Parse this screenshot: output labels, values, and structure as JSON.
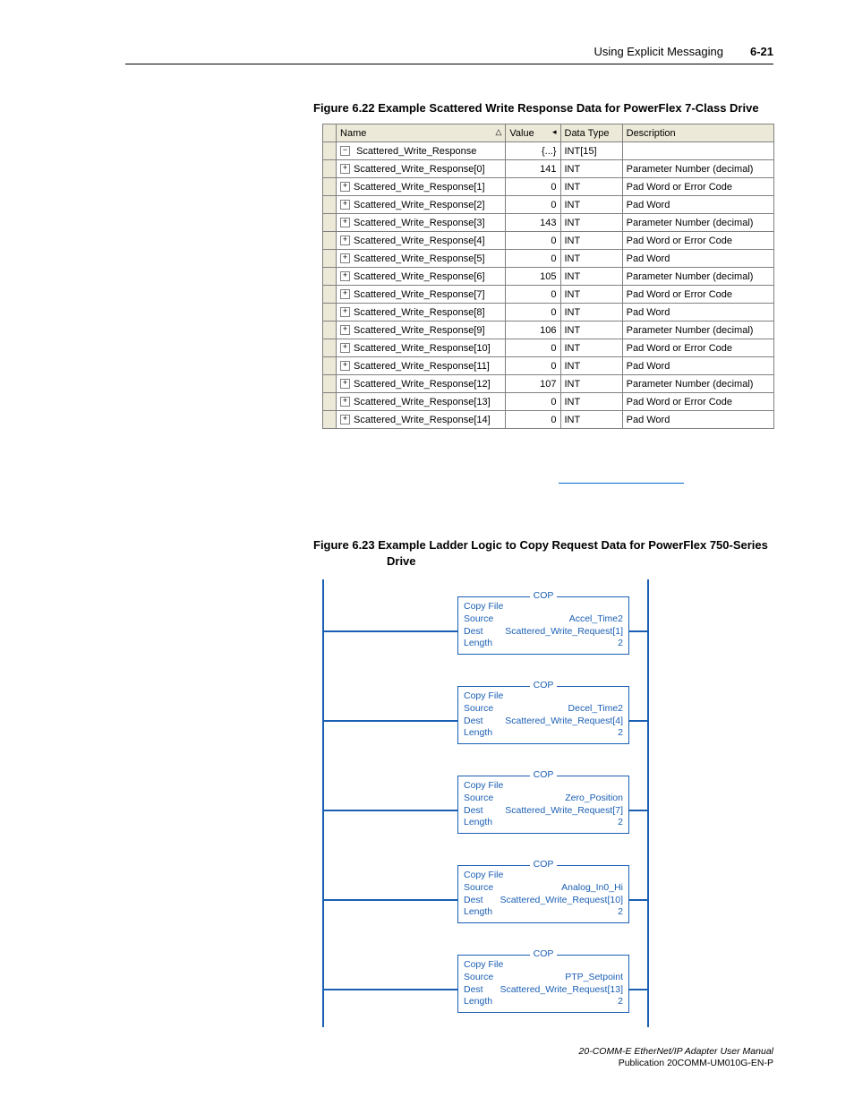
{
  "header": {
    "chapter": "Using Explicit Messaging",
    "pagenum": "6-21"
  },
  "fig622": {
    "caption": "Figure 6.22   Example Scattered Write Response Data for PowerFlex 7-Class Drive",
    "columns": {
      "name": "Name",
      "value": "Value",
      "type": "Data Type",
      "desc": "Description"
    },
    "root": {
      "name": "Scattered_Write_Response",
      "value": "{...}",
      "type": "INT[15]",
      "desc": ""
    },
    "rows": [
      {
        "name": "Scattered_Write_Response[0]",
        "value": "141",
        "type": "INT",
        "desc": "Parameter Number (decimal)"
      },
      {
        "name": "Scattered_Write_Response[1]",
        "value": "0",
        "type": "INT",
        "desc": "Pad Word or Error Code"
      },
      {
        "name": "Scattered_Write_Response[2]",
        "value": "0",
        "type": "INT",
        "desc": "Pad Word"
      },
      {
        "name": "Scattered_Write_Response[3]",
        "value": "143",
        "type": "INT",
        "desc": "Parameter Number (decimal)"
      },
      {
        "name": "Scattered_Write_Response[4]",
        "value": "0",
        "type": "INT",
        "desc": "Pad Word or Error Code"
      },
      {
        "name": "Scattered_Write_Response[5]",
        "value": "0",
        "type": "INT",
        "desc": "Pad Word"
      },
      {
        "name": "Scattered_Write_Response[6]",
        "value": "105",
        "type": "INT",
        "desc": "Parameter Number (decimal)"
      },
      {
        "name": "Scattered_Write_Response[7]",
        "value": "0",
        "type": "INT",
        "desc": "Pad Word or Error Code"
      },
      {
        "name": "Scattered_Write_Response[8]",
        "value": "0",
        "type": "INT",
        "desc": "Pad Word"
      },
      {
        "name": "Scattered_Write_Response[9]",
        "value": "106",
        "type": "INT",
        "desc": "Parameter Number (decimal)"
      },
      {
        "name": "Scattered_Write_Response[10]",
        "value": "0",
        "type": "INT",
        "desc": "Pad Word or Error Code"
      },
      {
        "name": "Scattered_Write_Response[11]",
        "value": "0",
        "type": "INT",
        "desc": "Pad Word"
      },
      {
        "name": "Scattered_Write_Response[12]",
        "value": "107",
        "type": "INT",
        "desc": "Parameter Number (decimal)"
      },
      {
        "name": "Scattered_Write_Response[13]",
        "value": "0",
        "type": "INT",
        "desc": "Pad Word or Error Code"
      },
      {
        "name": "Scattered_Write_Response[14]",
        "value": "0",
        "type": "INT",
        "desc": "Pad Word"
      }
    ]
  },
  "fig623": {
    "caption_line": "Figure 6.23   Example Ladder Logic to Copy Request Data for PowerFlex 750-Series",
    "caption_indent": "Drive",
    "rungs": [
      {
        "title": "COP",
        "func": "Copy File",
        "source_lbl": "Source",
        "source_val": "Accel_Time2",
        "dest_lbl": "Dest",
        "dest_val": "Scattered_Write_Request[1]",
        "len_lbl": "Length",
        "len_val": "2"
      },
      {
        "title": "COP",
        "func": "Copy File",
        "source_lbl": "Source",
        "source_val": "Decel_Time2",
        "dest_lbl": "Dest",
        "dest_val": "Scattered_Write_Request[4]",
        "len_lbl": "Length",
        "len_val": "2"
      },
      {
        "title": "COP",
        "func": "Copy File",
        "source_lbl": "Source",
        "source_val": "Zero_Position",
        "dest_lbl": "Dest",
        "dest_val": "Scattered_Write_Request[7]",
        "len_lbl": "Length",
        "len_val": "2"
      },
      {
        "title": "COP",
        "func": "Copy File",
        "source_lbl": "Source",
        "source_val": "Analog_In0_Hi",
        "dest_lbl": "Dest",
        "dest_val": "Scattered_Write_Request[10]",
        "len_lbl": "Length",
        "len_val": "2"
      },
      {
        "title": "COP",
        "func": "Copy File",
        "source_lbl": "Source",
        "source_val": "PTP_Setpoint",
        "dest_lbl": "Dest",
        "dest_val": "Scattered_Write_Request[13]",
        "len_lbl": "Length",
        "len_val": "2"
      }
    ]
  },
  "footer": {
    "l1": "20-COMM-E EtherNet/IP Adapter User Manual",
    "l2": "Publication 20COMM-UM010G-EN-P"
  },
  "icons": {
    "plus": "+",
    "minus": "−",
    "sort_up": "△",
    "sort_left": "◂"
  }
}
